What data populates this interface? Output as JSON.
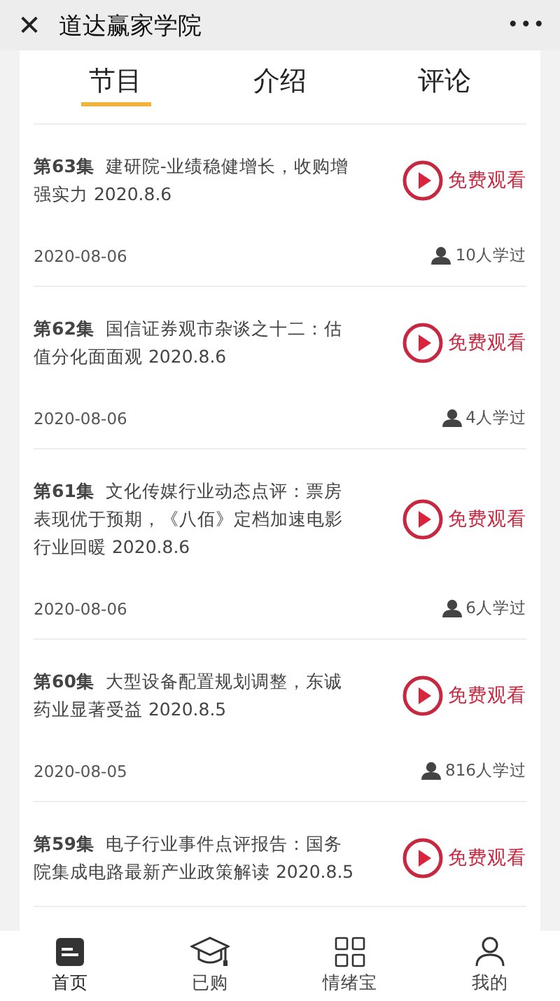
{
  "window": {
    "title": "道达赢家学院",
    "close_icon": "✕",
    "more_icon": "•••"
  },
  "tabs": [
    {
      "label": "节目",
      "selected": true
    },
    {
      "label": "介绍",
      "selected": false
    },
    {
      "label": "评论",
      "selected": false
    }
  ],
  "episodes": [
    {
      "title": "**第63集**  建研院-业绩稳健增长，收购增强实力 2020.8.6",
      "action": "免费观看",
      "date": "2020-08-06",
      "learners": "10人学过"
    },
    {
      "title": "**第62集**  国信证券观市杂谈之十二：估值分化面面观 2020.8.6",
      "action": "免费观看",
      "date": "2020-08-06",
      "learners": "4人学过"
    },
    {
      "title": "**第61集**  文化传媒行业动态点评：票房表现优于预期，《八佰》定档加速电影行业回暖 2020.8.6",
      "action": "免费观看",
      "date": "2020-08-06",
      "learners": "6人学过"
    },
    {
      "title": "**第60集**  大型设备配置规划调整，东诚药业显著受益 2020.8.5",
      "action": "免费观看",
      "date": "2020-08-05",
      "learners": "816人学过"
    },
    {
      "title": "**第59集**  电子行业事件点评报告：国务院集成电路最新产业政策解读 2020.8.5",
      "action": "免费观看"
    }
  ],
  "bottom_nav": [
    {
      "kind": "home",
      "label": "首页",
      "selected": true
    },
    {
      "kind": "purchased",
      "label": "已购",
      "selected": false
    },
    {
      "kind": "grid",
      "label": "情绪宝",
      "selected": false
    },
    {
      "kind": "profile",
      "label": "我的",
      "selected": false
    }
  ]
}
